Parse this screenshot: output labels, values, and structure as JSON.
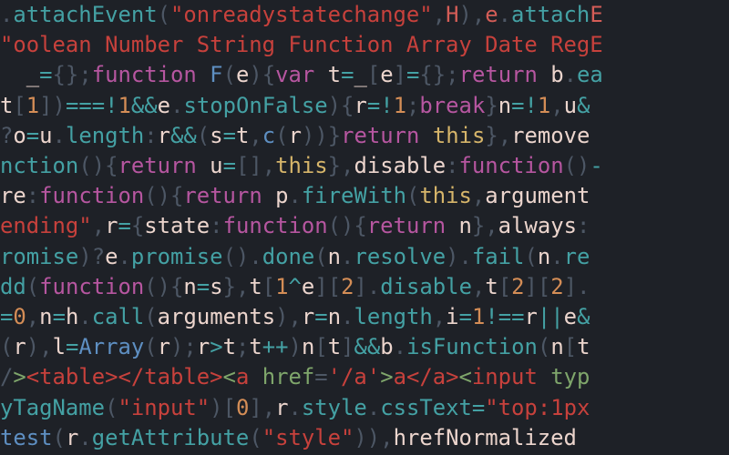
{
  "code": {
    "lines": [
      {
        "frags": [
          {
            "c": "pn",
            "t": "."
          },
          {
            "c": "mth",
            "t": "attachEvent"
          },
          {
            "c": "pn",
            "t": "("
          },
          {
            "c": "str",
            "t": "\"onreadystatechange\""
          },
          {
            "c": "pn",
            "t": ","
          },
          {
            "c": "ehl",
            "t": "H"
          },
          {
            "c": "pn",
            "t": "),"
          },
          {
            "c": "ehl",
            "t": "e"
          },
          {
            "c": "pn",
            "t": "."
          },
          {
            "c": "mth",
            "t": "attach"
          },
          {
            "c": "ehl",
            "t": "E"
          }
        ]
      },
      {
        "frags": [
          {
            "c": "str",
            "t": "\"oolean Number String Function Array Date RegE"
          }
        ]
      },
      {
        "frags": [
          {
            "c": "id",
            "t": "  _"
          },
          {
            "c": "op",
            "t": "="
          },
          {
            "c": "pn",
            "t": "{};"
          },
          {
            "c": "kw",
            "t": "function"
          },
          {
            "c": "id",
            "t": " "
          },
          {
            "c": "fn",
            "t": "F"
          },
          {
            "c": "pn",
            "t": "("
          },
          {
            "c": "id",
            "t": "e"
          },
          {
            "c": "pn",
            "t": "){"
          },
          {
            "c": "kw",
            "t": "var"
          },
          {
            "c": "id",
            "t": " t"
          },
          {
            "c": "op",
            "t": "="
          },
          {
            "c": "id",
            "t": "_"
          },
          {
            "c": "pn",
            "t": "["
          },
          {
            "c": "id",
            "t": "e"
          },
          {
            "c": "pn",
            "t": "]"
          },
          {
            "c": "op",
            "t": "="
          },
          {
            "c": "pn",
            "t": "{};"
          },
          {
            "c": "kw",
            "t": "return"
          },
          {
            "c": "id",
            "t": " b"
          },
          {
            "c": "pn",
            "t": "."
          },
          {
            "c": "mth",
            "t": "ea"
          }
        ]
      },
      {
        "frags": [
          {
            "c": "id",
            "t": "t"
          },
          {
            "c": "pn",
            "t": "["
          },
          {
            "c": "num",
            "t": "1"
          },
          {
            "c": "pn",
            "t": "])"
          },
          {
            "c": "op",
            "t": "===!"
          },
          {
            "c": "num",
            "t": "1"
          },
          {
            "c": "op",
            "t": "&&"
          },
          {
            "c": "id",
            "t": "e"
          },
          {
            "c": "pn",
            "t": "."
          },
          {
            "c": "mth",
            "t": "stopOnFalse"
          },
          {
            "c": "pn",
            "t": "){"
          },
          {
            "c": "id",
            "t": "r"
          },
          {
            "c": "op",
            "t": "=!"
          },
          {
            "c": "num",
            "t": "1"
          },
          {
            "c": "pn",
            "t": ";"
          },
          {
            "c": "kw",
            "t": "break"
          },
          {
            "c": "pn",
            "t": "}"
          },
          {
            "c": "id",
            "t": "n"
          },
          {
            "c": "op",
            "t": "=!"
          },
          {
            "c": "num",
            "t": "1"
          },
          {
            "c": "pn",
            "t": ","
          },
          {
            "c": "id",
            "t": "u"
          },
          {
            "c": "op",
            "t": "&"
          }
        ]
      },
      {
        "frags": [
          {
            "c": "pn",
            "t": "?"
          },
          {
            "c": "id",
            "t": "o"
          },
          {
            "c": "op",
            "t": "="
          },
          {
            "c": "id",
            "t": "u"
          },
          {
            "c": "pn",
            "t": "."
          },
          {
            "c": "mth",
            "t": "length"
          },
          {
            "c": "pn",
            "t": ":"
          },
          {
            "c": "id",
            "t": "r"
          },
          {
            "c": "op",
            "t": "&&"
          },
          {
            "c": "pn",
            "t": "("
          },
          {
            "c": "id",
            "t": "s"
          },
          {
            "c": "op",
            "t": "="
          },
          {
            "c": "id",
            "t": "t"
          },
          {
            "c": "pn",
            "t": ","
          },
          {
            "c": "fn",
            "t": "c"
          },
          {
            "c": "pn",
            "t": "("
          },
          {
            "c": "id",
            "t": "r"
          },
          {
            "c": "pn",
            "t": "))}"
          },
          {
            "c": "kw",
            "t": "return"
          },
          {
            "c": "id",
            "t": " "
          },
          {
            "c": "this",
            "t": "this"
          },
          {
            "c": "pn",
            "t": "},"
          },
          {
            "c": "id",
            "t": "remove"
          }
        ]
      },
      {
        "frags": [
          {
            "c": "mth",
            "t": "nction"
          },
          {
            "c": "pn",
            "t": "(){"
          },
          {
            "c": "kw",
            "t": "return"
          },
          {
            "c": "id",
            "t": " u"
          },
          {
            "c": "op",
            "t": "="
          },
          {
            "c": "pn",
            "t": "[],"
          },
          {
            "c": "this",
            "t": "this"
          },
          {
            "c": "pn",
            "t": "},"
          },
          {
            "c": "id",
            "t": "disable"
          },
          {
            "c": "pn",
            "t": ":"
          },
          {
            "c": "kw",
            "t": "function"
          },
          {
            "c": "pn",
            "t": "()"
          },
          {
            "c": "op",
            "t": "-"
          }
        ]
      },
      {
        "frags": [
          {
            "c": "id",
            "t": "re"
          },
          {
            "c": "pn",
            "t": ":"
          },
          {
            "c": "kw",
            "t": "function"
          },
          {
            "c": "pn",
            "t": "(){"
          },
          {
            "c": "kw",
            "t": "return"
          },
          {
            "c": "id",
            "t": " p"
          },
          {
            "c": "pn",
            "t": "."
          },
          {
            "c": "mth",
            "t": "fireWith"
          },
          {
            "c": "pn",
            "t": "("
          },
          {
            "c": "this",
            "t": "this"
          },
          {
            "c": "pn",
            "t": ","
          },
          {
            "c": "id",
            "t": "argument"
          }
        ]
      },
      {
        "frags": [
          {
            "c": "str",
            "t": "ending\""
          },
          {
            "c": "pn",
            "t": ","
          },
          {
            "c": "id",
            "t": "r"
          },
          {
            "c": "op",
            "t": "="
          },
          {
            "c": "pn",
            "t": "{"
          },
          {
            "c": "id",
            "t": "state"
          },
          {
            "c": "pn",
            "t": ":"
          },
          {
            "c": "kw",
            "t": "function"
          },
          {
            "c": "pn",
            "t": "(){"
          },
          {
            "c": "kw",
            "t": "return"
          },
          {
            "c": "id",
            "t": " n"
          },
          {
            "c": "pn",
            "t": "},"
          },
          {
            "c": "id",
            "t": "always"
          },
          {
            "c": "pn",
            "t": ":"
          }
        ]
      },
      {
        "frags": [
          {
            "c": "mth",
            "t": "romise"
          },
          {
            "c": "pn",
            "t": ")?"
          },
          {
            "c": "id",
            "t": "e"
          },
          {
            "c": "pn",
            "t": "."
          },
          {
            "c": "mth",
            "t": "promise"
          },
          {
            "c": "pn",
            "t": "()."
          },
          {
            "c": "mth",
            "t": "done"
          },
          {
            "c": "pn",
            "t": "("
          },
          {
            "c": "id",
            "t": "n"
          },
          {
            "c": "pn",
            "t": "."
          },
          {
            "c": "mth",
            "t": "resolve"
          },
          {
            "c": "pn",
            "t": ")."
          },
          {
            "c": "mth",
            "t": "fail"
          },
          {
            "c": "pn",
            "t": "("
          },
          {
            "c": "id",
            "t": "n"
          },
          {
            "c": "pn",
            "t": "."
          },
          {
            "c": "mth",
            "t": "re"
          }
        ]
      },
      {
        "frags": [
          {
            "c": "mth",
            "t": "dd"
          },
          {
            "c": "pn",
            "t": "("
          },
          {
            "c": "kw",
            "t": "function"
          },
          {
            "c": "pn",
            "t": "(){"
          },
          {
            "c": "id",
            "t": "n"
          },
          {
            "c": "op",
            "t": "="
          },
          {
            "c": "id",
            "t": "s"
          },
          {
            "c": "pn",
            "t": "},"
          },
          {
            "c": "id",
            "t": "t"
          },
          {
            "c": "pn",
            "t": "["
          },
          {
            "c": "num",
            "t": "1"
          },
          {
            "c": "op",
            "t": "^"
          },
          {
            "c": "id",
            "t": "e"
          },
          {
            "c": "pn",
            "t": "]["
          },
          {
            "c": "num",
            "t": "2"
          },
          {
            "c": "pn",
            "t": "]."
          },
          {
            "c": "mth",
            "t": "disable"
          },
          {
            "c": "pn",
            "t": ","
          },
          {
            "c": "id",
            "t": "t"
          },
          {
            "c": "pn",
            "t": "["
          },
          {
            "c": "num",
            "t": "2"
          },
          {
            "c": "pn",
            "t": "]["
          },
          {
            "c": "num",
            "t": "2"
          },
          {
            "c": "pn",
            "t": "]."
          }
        ]
      },
      {
        "frags": [
          {
            "c": "op",
            "t": "="
          },
          {
            "c": "num",
            "t": "0"
          },
          {
            "c": "pn",
            "t": ","
          },
          {
            "c": "id",
            "t": "n"
          },
          {
            "c": "op",
            "t": "="
          },
          {
            "c": "id",
            "t": "h"
          },
          {
            "c": "pn",
            "t": "."
          },
          {
            "c": "mth",
            "t": "call"
          },
          {
            "c": "pn",
            "t": "("
          },
          {
            "c": "id",
            "t": "arguments"
          },
          {
            "c": "pn",
            "t": "),"
          },
          {
            "c": "id",
            "t": "r"
          },
          {
            "c": "op",
            "t": "="
          },
          {
            "c": "id",
            "t": "n"
          },
          {
            "c": "pn",
            "t": "."
          },
          {
            "c": "mth",
            "t": "length"
          },
          {
            "c": "pn",
            "t": ","
          },
          {
            "c": "id",
            "t": "i"
          },
          {
            "c": "op",
            "t": "="
          },
          {
            "c": "num",
            "t": "1"
          },
          {
            "c": "op",
            "t": "!=="
          },
          {
            "c": "id",
            "t": "r"
          },
          {
            "c": "op",
            "t": "||"
          },
          {
            "c": "id",
            "t": "e"
          },
          {
            "c": "op",
            "t": "&"
          }
        ]
      },
      {
        "frags": [
          {
            "c": "pn",
            "t": "("
          },
          {
            "c": "id",
            "t": "r"
          },
          {
            "c": "pn",
            "t": "),"
          },
          {
            "c": "id",
            "t": "l"
          },
          {
            "c": "op",
            "t": "="
          },
          {
            "c": "fn",
            "t": "Array"
          },
          {
            "c": "pn",
            "t": "("
          },
          {
            "c": "id",
            "t": "r"
          },
          {
            "c": "pn",
            "t": ");"
          },
          {
            "c": "id",
            "t": "r"
          },
          {
            "c": "op",
            "t": ">"
          },
          {
            "c": "id",
            "t": "t"
          },
          {
            "c": "pn",
            "t": ";"
          },
          {
            "c": "id",
            "t": "t"
          },
          {
            "c": "op",
            "t": "++"
          },
          {
            "c": "pn",
            "t": ")"
          },
          {
            "c": "id",
            "t": "n"
          },
          {
            "c": "pn",
            "t": "["
          },
          {
            "c": "id",
            "t": "t"
          },
          {
            "c": "pn",
            "t": "]"
          },
          {
            "c": "op",
            "t": "&&"
          },
          {
            "c": "id",
            "t": "b"
          },
          {
            "c": "pn",
            "t": "."
          },
          {
            "c": "mth",
            "t": "isFunction"
          },
          {
            "c": "pn",
            "t": "("
          },
          {
            "c": "id",
            "t": "n"
          },
          {
            "c": "pn",
            "t": "["
          },
          {
            "c": "id",
            "t": "t"
          }
        ]
      },
      {
        "frags": [
          {
            "c": "pn",
            "t": "/"
          },
          {
            "c": "grn",
            "t": ">"
          },
          {
            "c": "str",
            "t": "<table></table>"
          },
          {
            "c": "grn",
            "t": "<"
          },
          {
            "c": "str",
            "t": "a "
          },
          {
            "c": "grn",
            "t": "href"
          },
          {
            "c": "pn",
            "t": "="
          },
          {
            "c": "str",
            "t": "'/a'"
          },
          {
            "c": "grn",
            "t": ">"
          },
          {
            "c": "str",
            "t": "a</a>"
          },
          {
            "c": "grn",
            "t": "<"
          },
          {
            "c": "str",
            "t": "input "
          },
          {
            "c": "grn",
            "t": "typ"
          }
        ]
      },
      {
        "frags": [
          {
            "c": "mth",
            "t": "yTagName"
          },
          {
            "c": "pn",
            "t": "("
          },
          {
            "c": "str",
            "t": "\"input\""
          },
          {
            "c": "pn",
            "t": ")["
          },
          {
            "c": "num",
            "t": "0"
          },
          {
            "c": "pn",
            "t": "],"
          },
          {
            "c": "id",
            "t": "r"
          },
          {
            "c": "pn",
            "t": "."
          },
          {
            "c": "mth",
            "t": "style"
          },
          {
            "c": "pn",
            "t": "."
          },
          {
            "c": "mth",
            "t": "cssText"
          },
          {
            "c": "op",
            "t": "="
          },
          {
            "c": "str",
            "t": "\"top:1px"
          }
        ]
      },
      {
        "frags": [
          {
            "c": "fn",
            "t": "test"
          },
          {
            "c": "pn",
            "t": "("
          },
          {
            "c": "id",
            "t": "r"
          },
          {
            "c": "pn",
            "t": "."
          },
          {
            "c": "mth",
            "t": "getAttribute"
          },
          {
            "c": "pn",
            "t": "("
          },
          {
            "c": "str",
            "t": "\"style\""
          },
          {
            "c": "pn",
            "t": ")),"
          },
          {
            "c": "id",
            "t": "hrefNormalized"
          }
        ]
      }
    ]
  }
}
